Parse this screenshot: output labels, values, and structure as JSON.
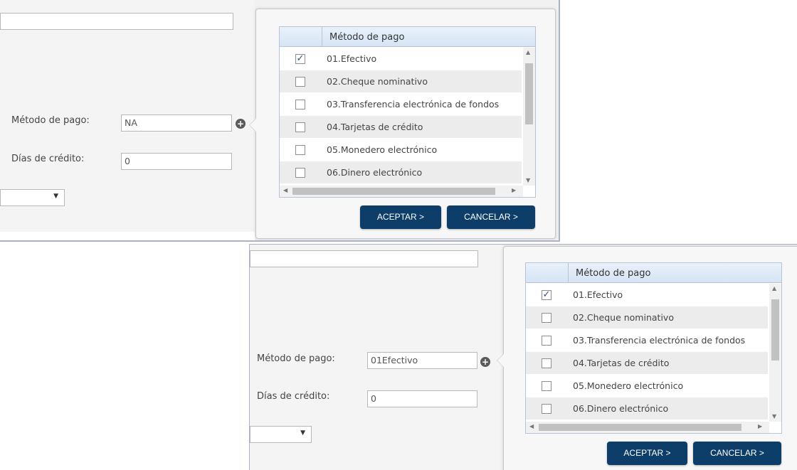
{
  "panels": [
    {
      "id": "top",
      "form": {
        "metodo_label": "Método de pago:",
        "metodo_value": "NA",
        "dias_label": "Días de crédito:",
        "dias_value": "0"
      },
      "grid": {
        "header": "Método de pago",
        "rows": [
          {
            "label": "01.Efectivo",
            "checked": true
          },
          {
            "label": "02.Cheque nominativo",
            "checked": false
          },
          {
            "label": "03.Transferencia electrónica de fondos",
            "checked": false
          },
          {
            "label": "04.Tarjetas de crédito",
            "checked": false
          },
          {
            "label": "05.Monedero electrónico",
            "checked": false
          },
          {
            "label": "06.Dinero electrónico",
            "checked": false
          }
        ]
      },
      "buttons": {
        "accept": "ACEPTAR >",
        "cancel": "CANCELAR >"
      }
    },
    {
      "id": "bottom",
      "form": {
        "metodo_label": "Método de pago:",
        "metodo_value": "01Efectivo",
        "dias_label": "Días de crédito:",
        "dias_value": "0"
      },
      "grid": {
        "header": "Método de pago",
        "rows": [
          {
            "label": "01.Efectivo",
            "checked": true
          },
          {
            "label": "02.Cheque nominativo",
            "checked": false
          },
          {
            "label": "03.Transferencia electrónica de fondos",
            "checked": false
          },
          {
            "label": "04.Tarjetas de crédito",
            "checked": false
          },
          {
            "label": "05.Monedero electrónico",
            "checked": false
          },
          {
            "label": "06.Dinero electrónico",
            "checked": false
          }
        ]
      },
      "buttons": {
        "accept": "ACEPTAR >",
        "cancel": "CANCELAR >"
      }
    }
  ],
  "icons": {
    "plus": "plus-circle-icon",
    "check": "checkmark-icon",
    "dropdown": "chevron-down-icon"
  },
  "colors": {
    "button": "#0d3e69",
    "grid_header": "#d6e4f4"
  }
}
